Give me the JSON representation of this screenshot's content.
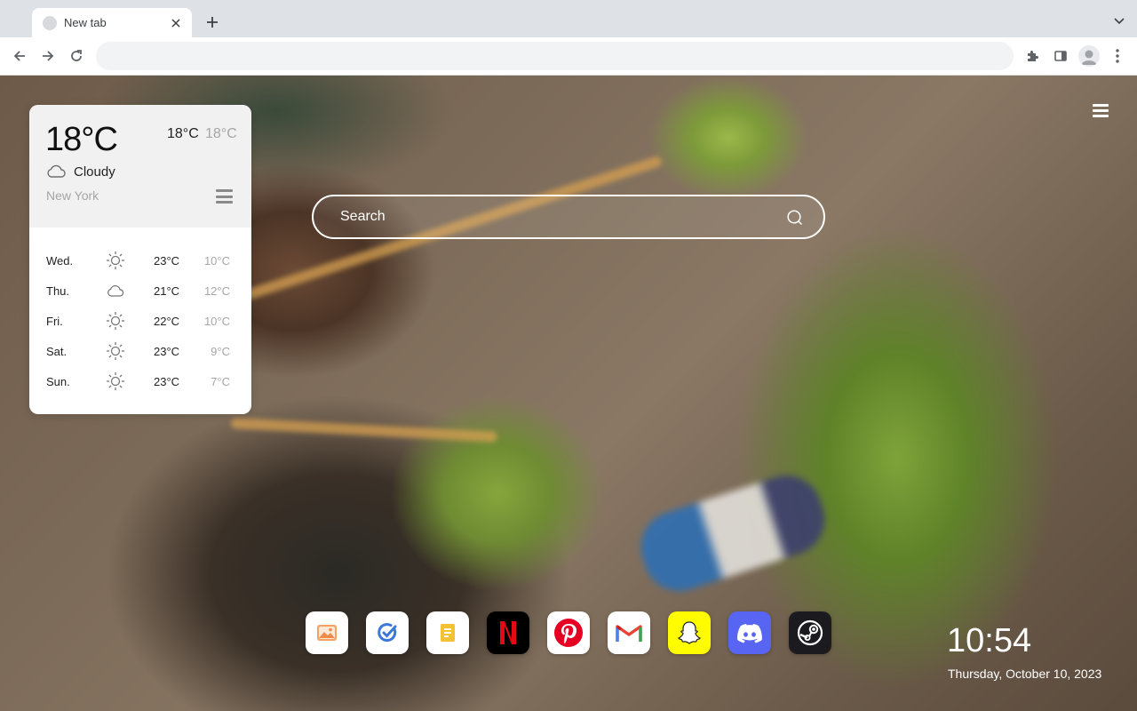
{
  "browser": {
    "tab_title": "New tab",
    "omnibox_value": "",
    "colors": {
      "chrome_bg": "#dee1e6",
      "toolbar_bg": "#ffffff",
      "omnibox_bg": "#f1f3f4"
    }
  },
  "weather": {
    "current_temp": "18°C",
    "high": "18°C",
    "low": "18°C",
    "condition": "Cloudy",
    "condition_icon": "cloud-icon",
    "city": "New York",
    "forecast": [
      {
        "day": "Wed.",
        "icon": "sun-icon",
        "high": "23°C",
        "low": "10°C"
      },
      {
        "day": "Thu.",
        "icon": "cloud-icon",
        "high": "21°C",
        "low": "12°C"
      },
      {
        "day": "Fri.",
        "icon": "sun-icon",
        "high": "22°C",
        "low": "10°C"
      },
      {
        "day": "Sat.",
        "icon": "sun-icon",
        "high": "23°C",
        "low": "9°C"
      },
      {
        "day": "Sun.",
        "icon": "sun-icon",
        "high": "23°C",
        "low": "7°C"
      }
    ]
  },
  "search": {
    "placeholder": "Search"
  },
  "dock": [
    {
      "name": "gallery",
      "icon": "photo-icon",
      "bg": "#ffffff",
      "accent": "#f08a4b"
    },
    {
      "name": "tasks",
      "icon": "check-circle-icon",
      "bg": "#ffffff",
      "accent": "#3c78d8"
    },
    {
      "name": "notes",
      "icon": "note-icon",
      "bg": "#ffffff",
      "accent": "#f2c233"
    },
    {
      "name": "netflix",
      "icon": "netflix-icon",
      "bg": "#000000",
      "accent": "#e50914"
    },
    {
      "name": "pinterest",
      "icon": "pinterest-icon",
      "bg": "#ffffff",
      "accent": "#e60023"
    },
    {
      "name": "gmail",
      "icon": "gmail-icon",
      "bg": "#ffffff",
      "accent": "#ea4335"
    },
    {
      "name": "snapchat",
      "icon": "snapchat-icon",
      "bg": "#fffc00",
      "accent": "#ffffff"
    },
    {
      "name": "discord",
      "icon": "discord-icon",
      "bg": "#5865f2",
      "accent": "#ffffff"
    },
    {
      "name": "steam",
      "icon": "steam-icon",
      "bg": "#1b1b1f",
      "accent": "#ffffff"
    }
  ],
  "clock": {
    "time": "10:54",
    "date": "Thursday, October 10, 2023"
  }
}
